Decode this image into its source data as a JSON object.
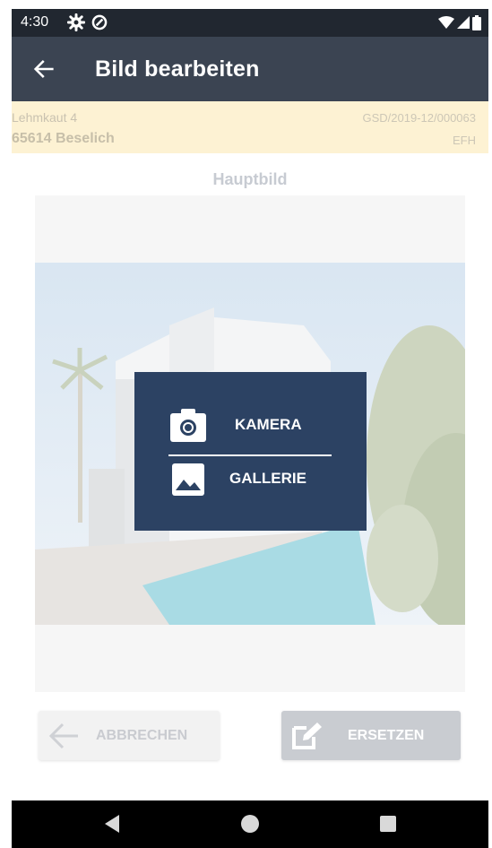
{
  "status": {
    "time": "4:30",
    "icons_left": [
      "gear-icon",
      "data-saver-icon"
    ],
    "icons_right": [
      "wifi-icon",
      "cell-signal-icon",
      "battery-icon"
    ]
  },
  "appbar": {
    "title": "Bild bearbeiten",
    "back_icon": "arrow-left-icon"
  },
  "address": {
    "street": "Lehmkaut 4",
    "city": "65614 Beselich",
    "reference": "GSD/2019-12/000063",
    "type": "EFH"
  },
  "image_section": {
    "title": "Hauptbild"
  },
  "menu": {
    "items": [
      {
        "label": "KAMERA",
        "icon": "camera-icon"
      },
      {
        "label": "GALLERIE",
        "icon": "image-icon"
      }
    ]
  },
  "buttons": {
    "cancel": {
      "label": "ABBRECHEN",
      "icon": "arrow-left-icon"
    },
    "replace": {
      "label": "ERSETZEN",
      "icon": "edit-icon"
    }
  },
  "nav": {
    "items": [
      "back-triangle-icon",
      "home-circle-icon",
      "recents-square-icon"
    ]
  },
  "colors": {
    "status_bar": "#212730",
    "app_bar": "#3b4452",
    "banner": "#fdf2d3",
    "menu_bg": "#2c4263",
    "nav_bar": "#000000"
  }
}
